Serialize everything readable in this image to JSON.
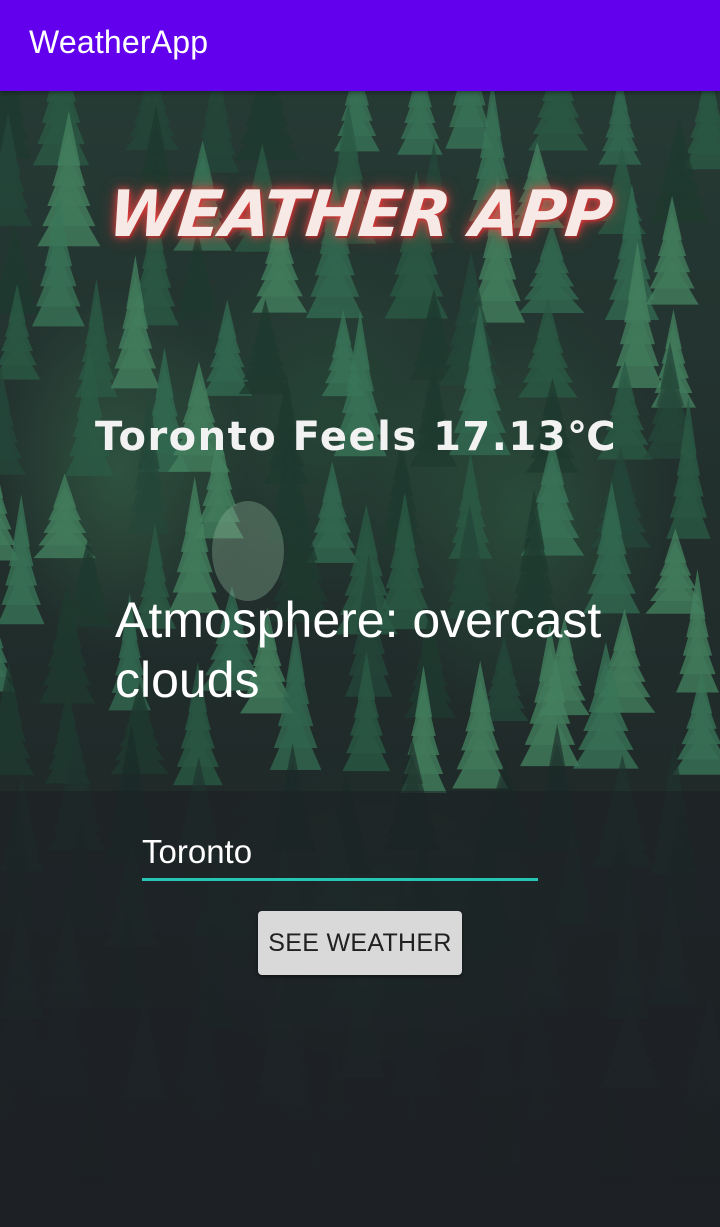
{
  "app_bar": {
    "title": "WeatherApp",
    "color": "#6200ee"
  },
  "main": {
    "heading": "WEATHER APP",
    "feels_text": "Toronto Feels 17.13℃",
    "atmosphere_text": "Atmosphere: overcast clouds",
    "city_input": {
      "value": "Toronto",
      "underline_color": "#26c6b6"
    },
    "see_weather_button": {
      "label": "SEE WEATHER"
    }
  }
}
